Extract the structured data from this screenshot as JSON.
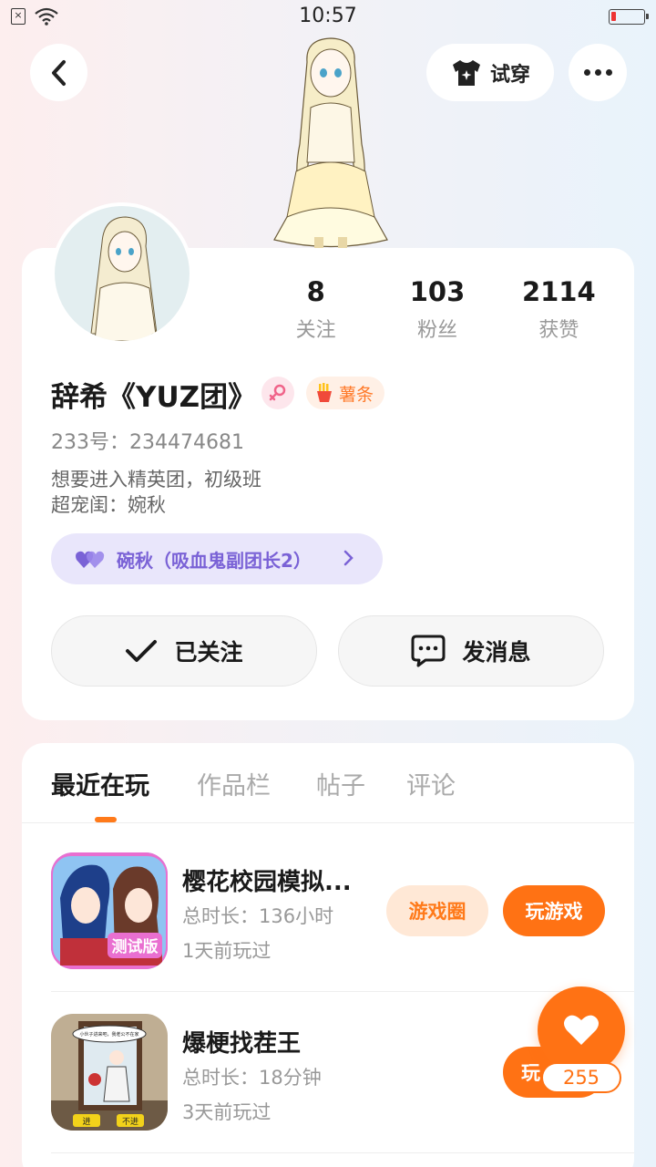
{
  "status_bar": {
    "time": "10:57",
    "sim_glyph": "×"
  },
  "header": {
    "tryon_label": "试穿"
  },
  "profile": {
    "stats": [
      {
        "num": "8",
        "label": "关注"
      },
      {
        "num": "103",
        "label": "粉丝"
      },
      {
        "num": "2114",
        "label": "获赞"
      }
    ],
    "username": "辞希《YUZ团》",
    "level_label": "薯条",
    "user_id": "233号：234474681",
    "bio_line1": "想要进入精英团，初级班",
    "bio_line2": "超宠闺：婉秋",
    "cp_label": "碗秋（吸血鬼副团长2）",
    "follow_label": "已关注",
    "message_label": "发消息"
  },
  "tabs": [
    "最近在玩",
    "作品栏",
    "帖子",
    "评论"
  ],
  "games": [
    {
      "title": "樱花校园模拟...",
      "duration": "总时长：136小时",
      "last_played": "1天前玩过",
      "circle_label": "游戏圈",
      "play_label": "玩游戏",
      "icon_text": "测试版"
    },
    {
      "title": "爆梗找茬王",
      "duration": "总时长：18分钟",
      "last_played": "3天前玩过",
      "play_label": "玩",
      "icon_text_1": "进",
      "icon_text_2": "不进",
      "icon_bubble": "小伙子进来吧，我老公不在家"
    }
  ],
  "float_like": {
    "count": "255"
  },
  "colors": {
    "accent": "#ff7214",
    "cp_purple": "#7a62d6"
  }
}
